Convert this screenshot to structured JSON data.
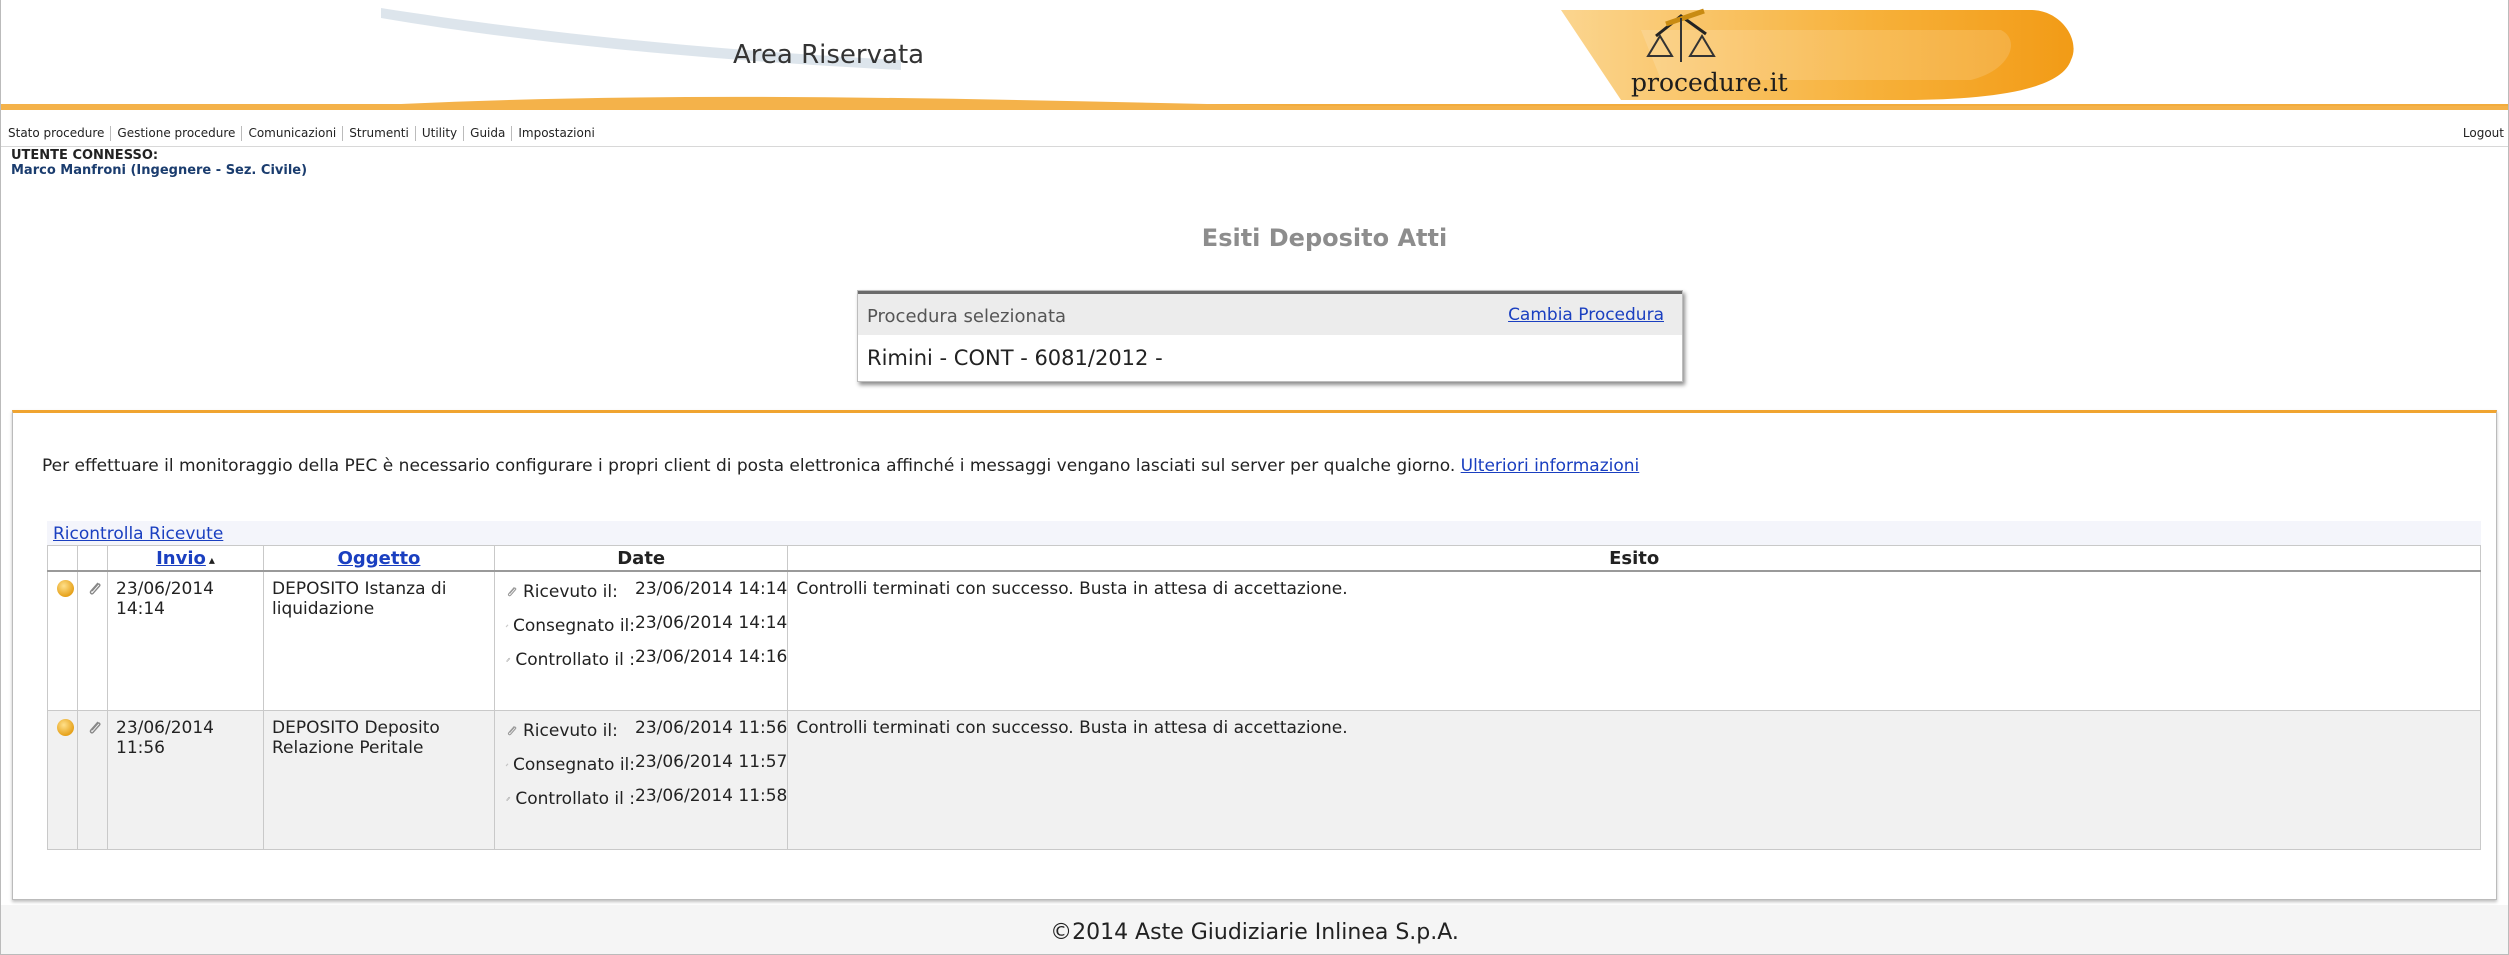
{
  "header": {
    "area_title": "Area Riservata",
    "logo_text": "procedure.it"
  },
  "menu": {
    "items": [
      {
        "label": "Stato procedure"
      },
      {
        "label": "Gestione procedure"
      },
      {
        "label": "Comunicazioni"
      },
      {
        "label": "Strumenti"
      },
      {
        "label": "Utility"
      },
      {
        "label": "Guida"
      },
      {
        "label": "Impostazioni"
      }
    ],
    "logout": "Logout"
  },
  "user": {
    "label": "UTENTE CONNESSO:",
    "name": "Marco Manfroni (Ingegnere - Sez. Civile)"
  },
  "page_title": "Esiti Deposito Atti",
  "procedure": {
    "label": "Procedura selezionata",
    "change_link": "Cambia Procedura",
    "value": "Rimini - CONT - 6081/2012 -"
  },
  "pec_note": {
    "text": "Per effettuare il monitoraggio della PEC è necessario configurare i propri client di posta elettronica affinché i messaggi vengano lasciati sul server per qualche giorno.",
    "link": "Ulteriori informazioni"
  },
  "ricontrolla": "Ricontrolla Ricevute",
  "table": {
    "headers": {
      "invio": "Invio",
      "sort_indicator": "▴",
      "oggetto": "Oggetto",
      "date": "Date",
      "esito": "Esito"
    },
    "rows": [
      {
        "invio": "23/06/2014 14:14",
        "oggetto": "DEPOSITO Istanza di liquidazione",
        "dates": [
          {
            "label": "Ricevuto il:",
            "value": "23/06/2014 14:14"
          },
          {
            "label": "Consegnato il:",
            "value": "23/06/2014 14:14"
          },
          {
            "label": "Controllato il :",
            "value": "23/06/2014 14:16"
          }
        ],
        "esito": "Controlli terminati con successo. Busta in attesa di accettazione."
      },
      {
        "invio": "23/06/2014 11:56",
        "oggetto": "DEPOSITO Deposito Relazione Peritale",
        "dates": [
          {
            "label": "Ricevuto il:",
            "value": "23/06/2014 11:56"
          },
          {
            "label": "Consegnato il:",
            "value": "23/06/2014 11:57"
          },
          {
            "label": "Controllato il :",
            "value": "23/06/2014 11:58"
          }
        ],
        "esito": "Controlli terminati con successo. Busta in attesa di accettazione."
      }
    ]
  },
  "footer": "©2014 Aste Giudiziarie Inlinea S.p.A.",
  "colors": {
    "accent_orange": "#f0a430",
    "link_blue": "#1a3fc0",
    "user_blue": "#1a3c6e",
    "status_dot": "#e6a21c"
  },
  "icons": [
    "status-dot-icon",
    "paperclip-icon",
    "logo-scales-icon",
    "sort-ascending-icon"
  ]
}
